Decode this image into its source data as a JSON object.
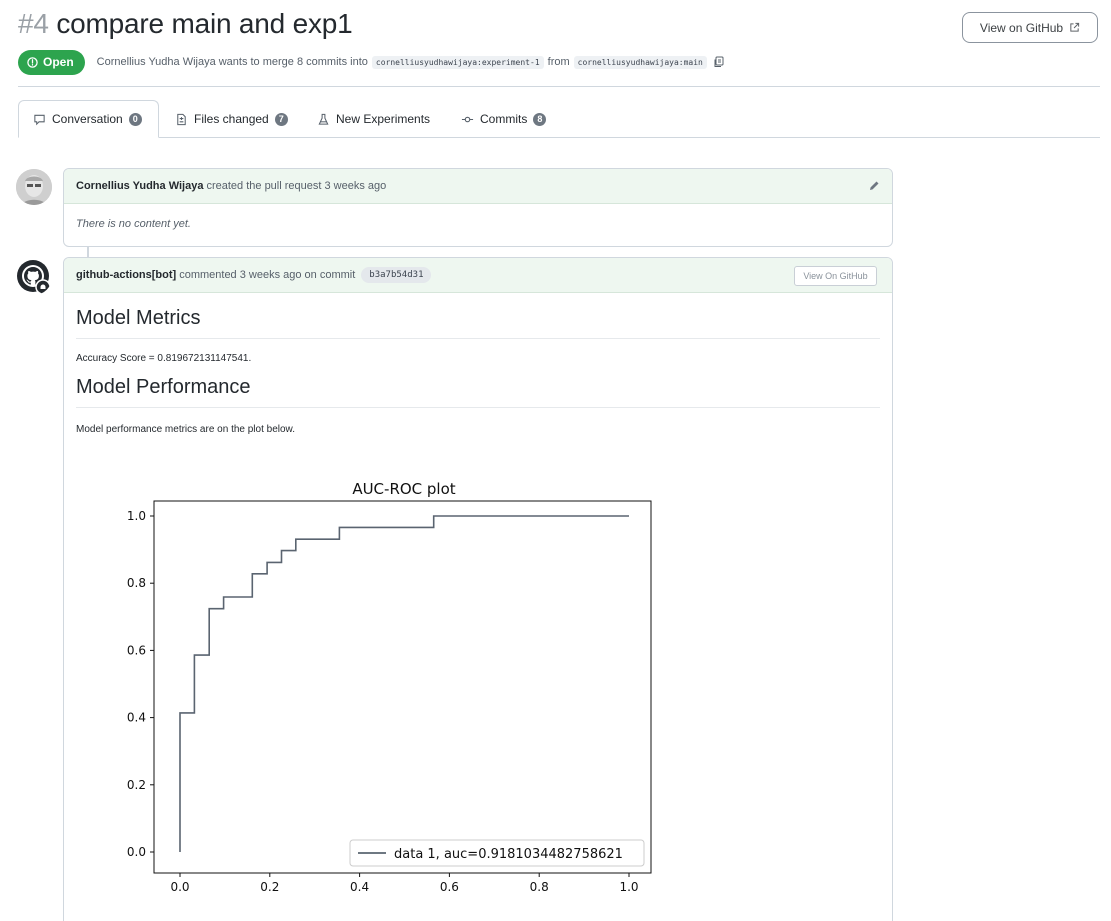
{
  "pr": {
    "number": "#4",
    "title": "compare main and exp1",
    "state": "Open",
    "author": "Cornellius Yudha Wijaya",
    "merge_text": "wants to merge 8 commits into",
    "base_branch": "cornelliusyudhawijaya:experiment-1",
    "from_text": "from",
    "head_branch": "cornelliusyudhawijaya:main",
    "view_button": "View on GitHub"
  },
  "tabs": [
    {
      "label": "Conversation",
      "count": "0",
      "icon": "comment-icon"
    },
    {
      "label": "Files changed",
      "count": "7",
      "icon": "file-diff-icon"
    },
    {
      "label": "New Experiments",
      "count": "",
      "icon": "beaker-icon"
    },
    {
      "label": "Commits",
      "count": "8",
      "icon": "commit-icon"
    }
  ],
  "timeline": {
    "first": {
      "author": "Cornellius Yudha Wijaya",
      "action": "created the pull request 3 weeks ago",
      "body": "There is no content yet."
    },
    "second": {
      "author": "github-actions[bot]",
      "action": "commented 3 weeks ago on commit",
      "sha": "b3a7b54d31",
      "button": "View On GitHub",
      "heading_metrics": "Model Metrics",
      "accuracy_text": "Accuracy Score = 0.819672131147541.",
      "heading_performance": "Model Performance",
      "performance_text": "Model performance metrics are on the plot below."
    }
  },
  "colors": {
    "open_green": "#2da44e",
    "roc_line": "#5a6470",
    "counter_bg": "#6e7781"
  },
  "chart_data": {
    "type": "line",
    "title": "AUC-ROC plot",
    "xlabel": "",
    "ylabel": "",
    "xlim": [
      0.0,
      1.0
    ],
    "ylim": [
      0.0,
      1.0
    ],
    "xticks": [
      "0.0",
      "0.2",
      "0.4",
      "0.6",
      "0.8",
      "1.0"
    ],
    "yticks": [
      "0.0",
      "0.2",
      "0.4",
      "0.6",
      "0.8",
      "1.0"
    ],
    "legend_position": "lower-right",
    "series": [
      {
        "name": "data 1, auc=0.9181034482758621",
        "x": [
          0.0,
          0.0,
          0.032,
          0.032,
          0.065,
          0.065,
          0.097,
          0.097,
          0.161,
          0.161,
          0.194,
          0.194,
          0.226,
          0.226,
          0.258,
          0.258,
          0.355,
          0.355,
          0.565,
          0.565,
          1.0
        ],
        "y": [
          0.0,
          0.414,
          0.414,
          0.586,
          0.586,
          0.724,
          0.724,
          0.759,
          0.759,
          0.828,
          0.828,
          0.862,
          0.862,
          0.897,
          0.897,
          0.931,
          0.931,
          0.966,
          0.966,
          1.0,
          1.0
        ]
      }
    ]
  }
}
